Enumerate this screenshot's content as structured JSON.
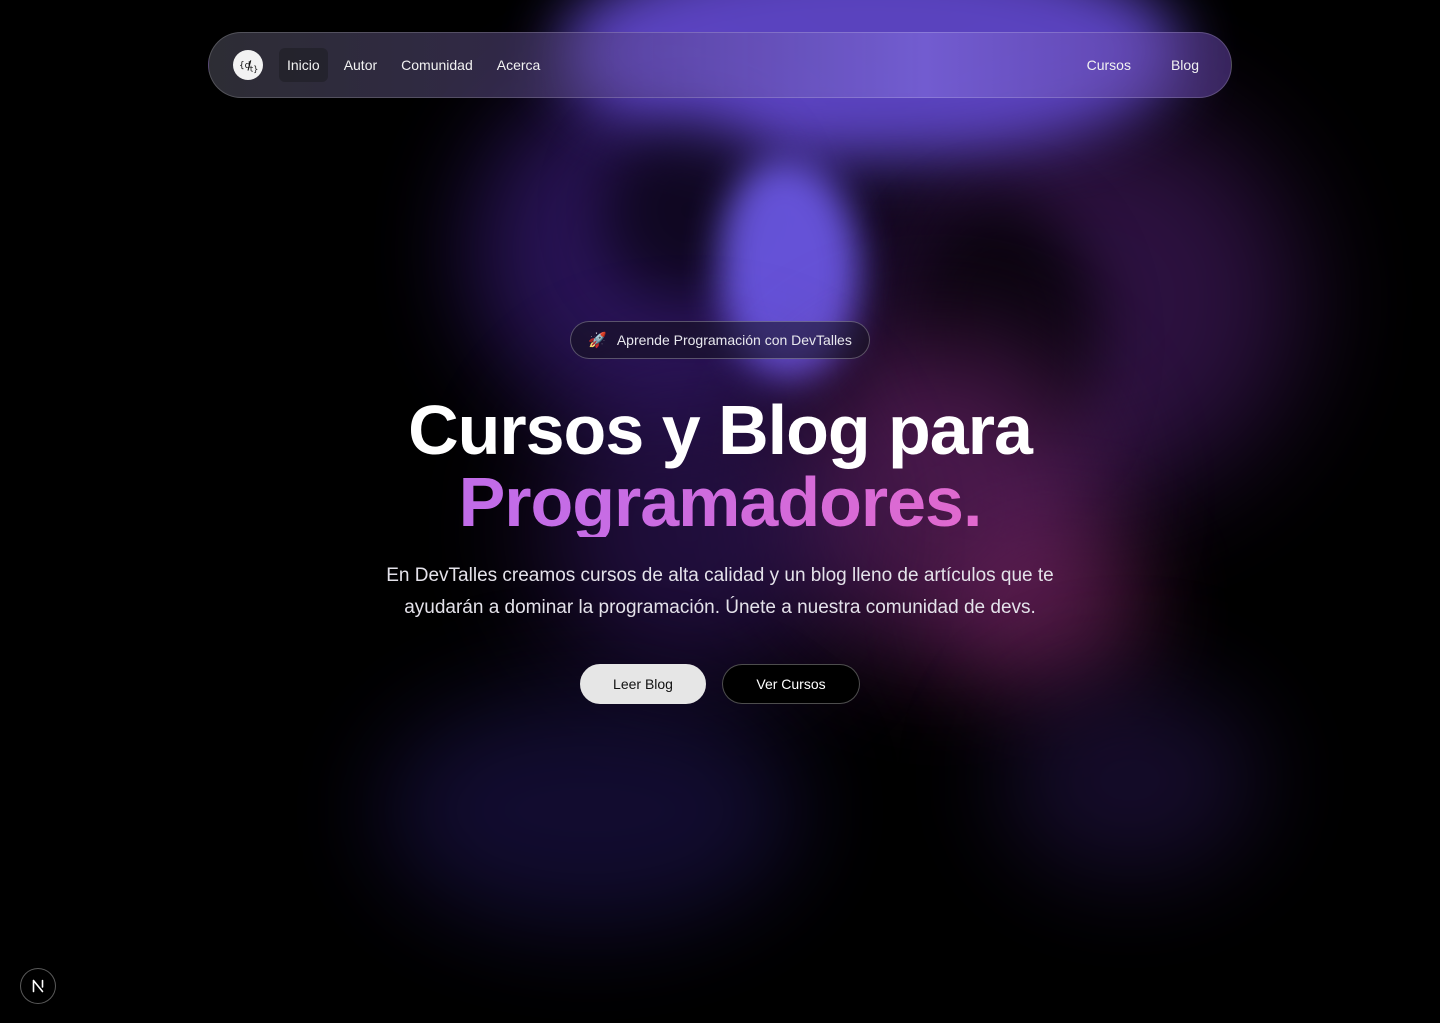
{
  "nav": {
    "logo_icon": "devtalles-logo-icon",
    "left_links": [
      "Inicio",
      "Autor",
      "Comunidad",
      "Acerca"
    ],
    "active": "Inicio",
    "right_links": [
      "Cursos",
      "Blog"
    ]
  },
  "hero": {
    "badge_icon": "rocket",
    "badge_text": "Aprende Programación con DevTalles",
    "title_line1": "Cursos y Blog para",
    "title_line2": "Programadores.",
    "subtitle": "En DevTalles creamos cursos de alta calidad y un blog lleno de artículos que te ayudarán a dominar la programación. Únete a nuestra comunidad de devs.",
    "primary_button": "Leer Blog",
    "secondary_button": "Ver Cursos"
  },
  "dev_badge": {
    "icon": "nextjs-icon"
  },
  "colors": {
    "background": "#000000",
    "title_gradient_start": "#b06cf0",
    "title_gradient_end": "#f46aa9",
    "primary_button_bg": "#e6e6e6"
  }
}
